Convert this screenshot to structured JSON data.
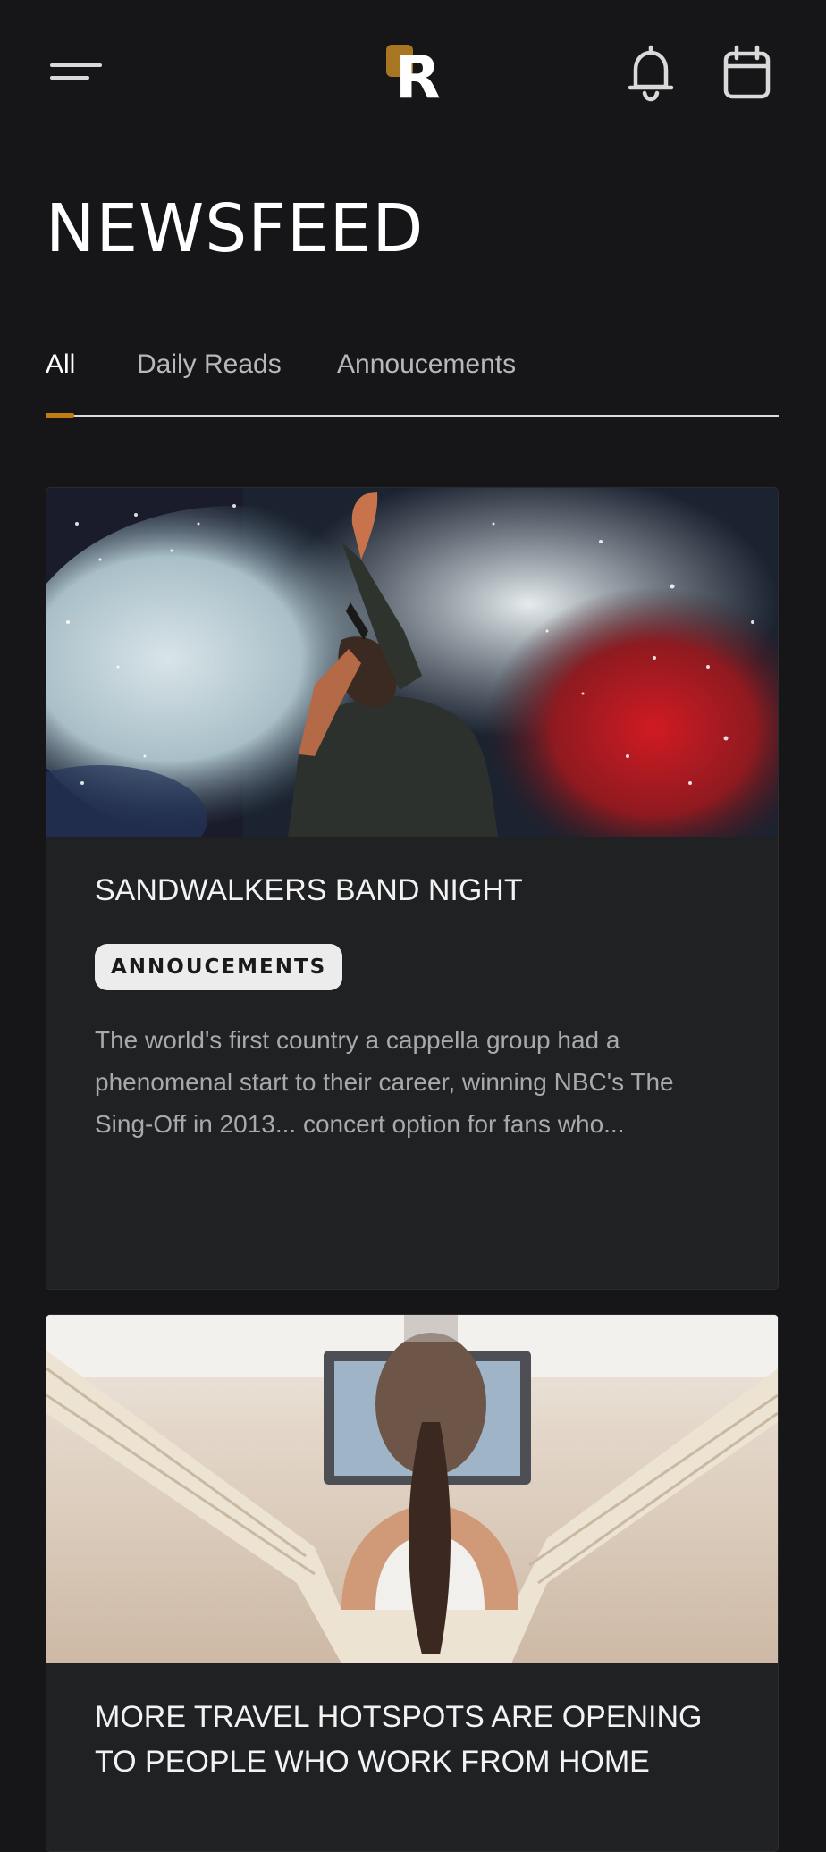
{
  "header": {
    "menu_icon": "hamburger-menu-icon",
    "logo_letter": "R",
    "logo_accent": "#a87622",
    "notification_icon": "bell-icon",
    "calendar_icon": "calendar-icon"
  },
  "page": {
    "title": "NEWSFEED"
  },
  "tabs": [
    {
      "label": "All",
      "active": true
    },
    {
      "label": "Daily Reads",
      "active": false
    },
    {
      "label": "Annoucements",
      "active": false
    }
  ],
  "colors": {
    "background": "#161618",
    "card_background": "#202123",
    "accent": "#c17d15",
    "tag_background": "#ececec"
  },
  "posts": [
    {
      "image": "concert-performer-photo",
      "title": "SANDWALKERS BAND NIGHT",
      "tag": "ANNOUCEMENTS",
      "excerpt": "The world's first country a cappella group had a phenomenal start to their career, winning NBC's The Sing-Off in 2013... concert option for fans who..."
    },
    {
      "image": "woman-hammock-laptop-beach-photo",
      "title": "MORE TRAVEL HOTSPOTS ARE OPENING TO PEOPLE WHO WORK FROM HOME"
    }
  ]
}
